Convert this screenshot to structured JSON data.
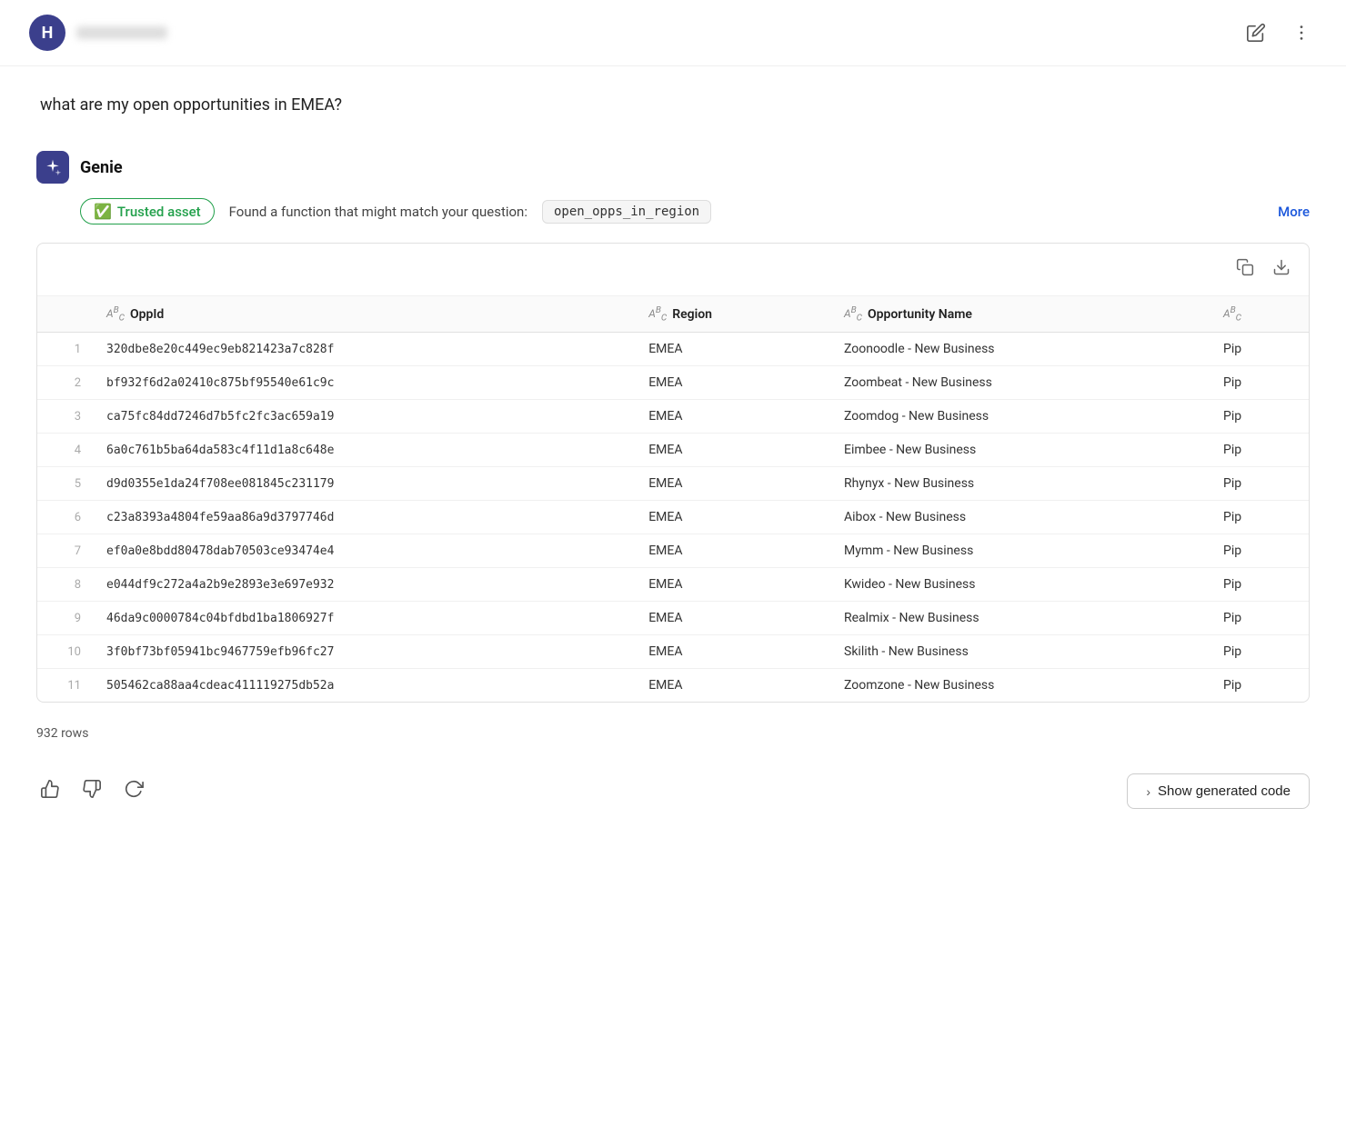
{
  "header": {
    "avatar_letter": "H",
    "username_placeholder": "username",
    "edit_icon_label": "edit",
    "more_icon_label": "more options"
  },
  "question": {
    "text": "what are my open opportunities in EMEA?"
  },
  "genie": {
    "label": "Genie",
    "trusted_asset_label": "Trusted asset",
    "found_text": "Found a function that might match your question:",
    "function_name": "open_opps_in_region",
    "more_label": "More"
  },
  "table": {
    "copy_icon": "copy",
    "download_icon": "download",
    "columns": [
      {
        "id": "row_num",
        "label": "",
        "icon": false
      },
      {
        "id": "opp_id",
        "label": "OppId",
        "icon": "ABC"
      },
      {
        "id": "region",
        "label": "Region",
        "icon": "ABC"
      },
      {
        "id": "opp_name",
        "label": "Opportunity Name",
        "icon": "ABC"
      },
      {
        "id": "extra",
        "label": "",
        "icon": "ABC"
      }
    ],
    "rows": [
      {
        "row_num": 1,
        "opp_id": "320dbe8e20c449ec9eb821423a7c828f",
        "region": "EMEA",
        "opp_name": "Zoonoodle - New Business",
        "extra": "Pip"
      },
      {
        "row_num": 2,
        "opp_id": "bf932f6d2a02410c875bf95540e61c9c",
        "region": "EMEA",
        "opp_name": "Zoombeat - New Business",
        "extra": "Pip"
      },
      {
        "row_num": 3,
        "opp_id": "ca75fc84dd7246d7b5fc2fc3ac659a19",
        "region": "EMEA",
        "opp_name": "Zoomdog - New Business",
        "extra": "Pip"
      },
      {
        "row_num": 4,
        "opp_id": "6a0c761b5ba64da583c4f11d1a8c648e",
        "region": "EMEA",
        "opp_name": "Eimbee - New Business",
        "extra": "Pip"
      },
      {
        "row_num": 5,
        "opp_id": "d9d0355e1da24f708ee081845c231179",
        "region": "EMEA",
        "opp_name": "Rhynyx - New Business",
        "extra": "Pip"
      },
      {
        "row_num": 6,
        "opp_id": "c23a8393a4804fe59aa86a9d3797746d",
        "region": "EMEA",
        "opp_name": "Aibox - New Business",
        "extra": "Pip"
      },
      {
        "row_num": 7,
        "opp_id": "ef0a0e8bdd80478dab70503ce93474e4",
        "region": "EMEA",
        "opp_name": "Mymm - New Business",
        "extra": "Pip"
      },
      {
        "row_num": 8,
        "opp_id": "e044df9c272a4a2b9e2893e3e697e932",
        "region": "EMEA",
        "opp_name": "Kwideo - New Business",
        "extra": "Pip"
      },
      {
        "row_num": 9,
        "opp_id": "46da9c0000784c04bfdbd1ba1806927f",
        "region": "EMEA",
        "opp_name": "Realmix - New Business",
        "extra": "Pip"
      },
      {
        "row_num": 10,
        "opp_id": "3f0bf73bf05941bc9467759efb96fc27",
        "region": "EMEA",
        "opp_name": "Skilith - New Business",
        "extra": "Pip"
      },
      {
        "row_num": 11,
        "opp_id": "505462ca88aa4cdeac411119275db52a",
        "region": "EMEA",
        "opp_name": "Zoomzone - New Business",
        "extra": "Pip"
      }
    ],
    "row_count": "932 rows"
  },
  "bottom": {
    "thumbs_up_label": "thumbs up",
    "thumbs_down_label": "thumbs down",
    "refresh_label": "refresh",
    "show_code_label": "Show generated code"
  }
}
